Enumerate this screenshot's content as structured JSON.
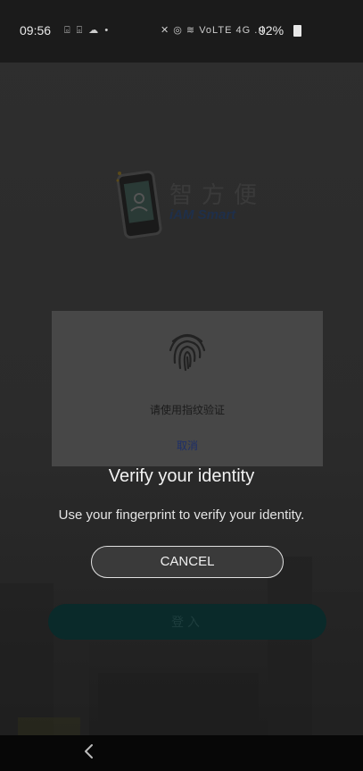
{
  "status_bar": {
    "time": "09:56",
    "left_icons": "⌻ ⌻ ☁ •",
    "right_icons": "✕ ◎ ≋ VoLTE 4G .ıl",
    "battery": "92%"
  },
  "app": {
    "logo_cn": "智方便",
    "logo_en": "iAM Smart",
    "login_label": "登入"
  },
  "inner_dialog": {
    "prompt": "请使用指纹验证",
    "cancel_label": "取消"
  },
  "biometric_prompt": {
    "title": "Verify your identity",
    "subtitle": "Use your fingerprint to verify your identity.",
    "cancel_label": "CANCEL"
  },
  "nav_bar": {
    "back_icon": "chevron-left-icon"
  }
}
